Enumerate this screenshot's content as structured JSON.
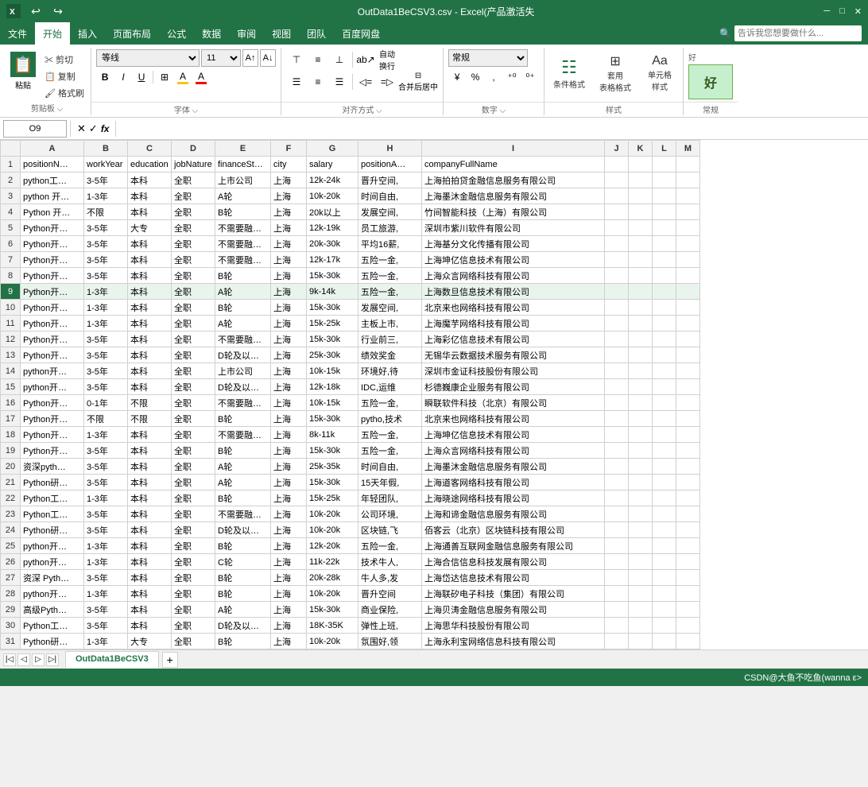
{
  "titleBar": {
    "filename": "OutData1BeCSV3.csv - Excel(产品激活失",
    "iconLabel": "Excel"
  },
  "menuBar": {
    "items": [
      "文件",
      "开始",
      "插入",
      "页面布局",
      "公式",
      "数据",
      "审阅",
      "视图",
      "团队",
      "百度网盘"
    ],
    "activeItem": "开始",
    "searchPlaceholder": "告诉我您想要做什么..."
  },
  "ribbon": {
    "clipboard": {
      "paste": "粘贴",
      "cut": "✂ 剪切",
      "copy": "📋 复制",
      "formatPainter": "🖌 格式刷"
    },
    "font": {
      "name": "等线",
      "size": "11",
      "bold": "B",
      "italic": "I",
      "underline": "U",
      "border": "⊞",
      "fillColor": "A",
      "fontColor": "A"
    },
    "alignment": {
      "wrapText": "自动换行",
      "mergeCenterLabel": "合并后居中"
    },
    "number": {
      "format": "常规",
      "percent": "%",
      "comma": ","
    },
    "styles": {
      "conditionalFormat": "条件格式",
      "tableFormat": "套用\n表格格式",
      "cellStyles": "单元格\n样式"
    },
    "goodStyle": {
      "preview": "好",
      "label": "好"
    }
  },
  "formulaBar": {
    "cellRef": "O9",
    "formula": ""
  },
  "columns": {
    "headers": [
      "",
      "A",
      "B",
      "C",
      "D",
      "E",
      "F",
      "G",
      "H",
      "I",
      "J",
      "K",
      "L",
      "M"
    ],
    "widths": [
      25,
      80,
      55,
      55,
      55,
      70,
      45,
      65,
      80,
      230,
      30,
      30,
      30,
      30
    ]
  },
  "rows": [
    {
      "num": 1,
      "cells": [
        "positionN…",
        "workYear",
        "education",
        "jobNature",
        "financeSt…",
        "city",
        "salary",
        "positionA…",
        "companyFullName",
        "",
        "",
        "",
        ""
      ]
    },
    {
      "num": 2,
      "cells": [
        "python工…",
        "3-5年",
        "本科",
        "全职",
        "上市公司",
        "上海",
        "12k-24k",
        "晋升空间,",
        "上海拍拍贷金融信息服务有限公司",
        "",
        "",
        "",
        ""
      ]
    },
    {
      "num": 3,
      "cells": [
        "python 开…",
        "1-3年",
        "本科",
        "全职",
        "A轮",
        "上海",
        "10k-20k",
        "时间自由,",
        "上海墨沐金融信息服务有限公司",
        "",
        "",
        "",
        ""
      ]
    },
    {
      "num": 4,
      "cells": [
        "Python 开…",
        "不限",
        "本科",
        "全职",
        "B轮",
        "上海",
        "20k以上",
        "发展空间,",
        "竹间智能科技（上海）有限公司",
        "",
        "",
        "",
        ""
      ]
    },
    {
      "num": 5,
      "cells": [
        "Python开…",
        "3-5年",
        "大专",
        "全职",
        "不需要融…",
        "上海",
        "12k-19k",
        "员工旅游,",
        "深圳市紫川软件有限公司",
        "",
        "",
        "",
        ""
      ]
    },
    {
      "num": 6,
      "cells": [
        "Python开…",
        "3-5年",
        "本科",
        "全职",
        "不需要融…",
        "上海",
        "20k-30k",
        "平均16薪,",
        "上海基分文化传播有限公司",
        "",
        "",
        "",
        ""
      ]
    },
    {
      "num": 7,
      "cells": [
        "Python开…",
        "3-5年",
        "本科",
        "全职",
        "不需要融…",
        "上海",
        "12k-17k",
        "五险一金,",
        "上海坤亿信息技术有限公司",
        "",
        "",
        "",
        ""
      ]
    },
    {
      "num": 8,
      "cells": [
        "Python开…",
        "3-5年",
        "本科",
        "全职",
        "B轮",
        "上海",
        "15k-30k",
        "五险一金,",
        "上海众言网络科技有限公司",
        "",
        "",
        "",
        ""
      ]
    },
    {
      "num": 9,
      "cells": [
        "Python开…",
        "1-3年",
        "本科",
        "全职",
        "A轮",
        "上海",
        "9k-14k",
        "五险一金,",
        "上海数旦信息技术有限公司",
        "",
        "",
        "",
        ""
      ],
      "selected": true
    },
    {
      "num": 10,
      "cells": [
        "Python开…",
        "1-3年",
        "本科",
        "全职",
        "B轮",
        "上海",
        "15k-30k",
        "发展空间,",
        "北京来也网络科技有限公司",
        "",
        "",
        "",
        ""
      ]
    },
    {
      "num": 11,
      "cells": [
        "Python开…",
        "1-3年",
        "本科",
        "全职",
        "A轮",
        "上海",
        "15k-25k",
        "主板上市,",
        "上海魔芋网络科技有限公司",
        "",
        "",
        "",
        ""
      ]
    },
    {
      "num": 12,
      "cells": [
        "Python开…",
        "3-5年",
        "本科",
        "全职",
        "不需要融…",
        "上海",
        "15k-30k",
        "行业前三,",
        "上海彩亿信息技术有限公司",
        "",
        "",
        "",
        ""
      ]
    },
    {
      "num": 13,
      "cells": [
        "Python开…",
        "3-5年",
        "本科",
        "全职",
        "D轮及以…",
        "上海",
        "25k-30k",
        "绩效奖金",
        "无锡华云数据技术服务有限公司",
        "",
        "",
        "",
        ""
      ]
    },
    {
      "num": 14,
      "cells": [
        "python开…",
        "3-5年",
        "本科",
        "全职",
        "上市公司",
        "上海",
        "10k-15k",
        "环境好,待",
        "深圳市金证科技股份有限公司",
        "",
        "",
        "",
        ""
      ]
    },
    {
      "num": 15,
      "cells": [
        "python开…",
        "3-5年",
        "本科",
        "全职",
        "D轮及以…",
        "上海",
        "12k-18k",
        "IDC,运维",
        "杉德巍康企业服务有限公司",
        "",
        "",
        "",
        ""
      ]
    },
    {
      "num": 16,
      "cells": [
        "Python开…",
        "0-1年",
        "不限",
        "全职",
        "不需要融…",
        "上海",
        "10k-15k",
        "五险一金,",
        "瞬联软件科技（北京）有限公司",
        "",
        "",
        "",
        ""
      ]
    },
    {
      "num": 17,
      "cells": [
        "Python开…",
        "不限",
        "不限",
        "全职",
        "B轮",
        "上海",
        "15k-30k",
        "pytho,技术",
        "北京来也网络科技有限公司",
        "",
        "",
        "",
        ""
      ]
    },
    {
      "num": 18,
      "cells": [
        "Python开…",
        "1-3年",
        "本科",
        "全职",
        "不需要融…",
        "上海",
        "8k-11k",
        "五险一金,",
        "上海坤亿信息技术有限公司",
        "",
        "",
        "",
        ""
      ]
    },
    {
      "num": 19,
      "cells": [
        "Python开…",
        "3-5年",
        "本科",
        "全职",
        "B轮",
        "上海",
        "15k-30k",
        "五险一金,",
        "上海众言网络科技有限公司",
        "",
        "",
        "",
        ""
      ]
    },
    {
      "num": 20,
      "cells": [
        "资深pyth…",
        "3-5年",
        "本科",
        "全职",
        "A轮",
        "上海",
        "25k-35k",
        "时间自由,",
        "上海墨沐金融信息服务有限公司",
        "",
        "",
        "",
        ""
      ]
    },
    {
      "num": 21,
      "cells": [
        "Python研…",
        "3-5年",
        "本科",
        "全职",
        "A轮",
        "上海",
        "15k-30k",
        "15天年假,",
        "上海道客网络科技有限公司",
        "",
        "",
        "",
        ""
      ]
    },
    {
      "num": 22,
      "cells": [
        "Python工…",
        "1-3年",
        "本科",
        "全职",
        "B轮",
        "上海",
        "15k-25k",
        "年轻团队,",
        "上海晓途网络科技有限公司",
        "",
        "",
        "",
        ""
      ]
    },
    {
      "num": 23,
      "cells": [
        "Python工…",
        "3-5年",
        "本科",
        "全职",
        "不需要融…",
        "上海",
        "10k-20k",
        "公司环境,",
        "上海和谛金融信息服务有限公司",
        "",
        "",
        "",
        ""
      ]
    },
    {
      "num": 24,
      "cells": [
        "Python研…",
        "3-5年",
        "本科",
        "全职",
        "D轮及以…",
        "上海",
        "10k-20k",
        "区块链,飞",
        "佰客云（北京）区块链科技有限公司",
        "",
        "",
        "",
        ""
      ]
    },
    {
      "num": 25,
      "cells": [
        "python开…",
        "1-3年",
        "本科",
        "全职",
        "B轮",
        "上海",
        "12k-20k",
        "五险一金,",
        "上海通善互联网金融信息服务有限公司",
        "",
        "",
        "",
        ""
      ]
    },
    {
      "num": 26,
      "cells": [
        "python开…",
        "1-3年",
        "本科",
        "全职",
        "C轮",
        "上海",
        "11k-22k",
        "技术牛人,",
        "上海合信信息科技发展有限公司",
        "",
        "",
        "",
        ""
      ]
    },
    {
      "num": 27,
      "cells": [
        "资深 Pyth…",
        "3-5年",
        "本科",
        "全职",
        "B轮",
        "上海",
        "20k-28k",
        "牛人多,发",
        "上海岱达信息技术有限公司",
        "",
        "",
        "",
        ""
      ]
    },
    {
      "num": 28,
      "cells": [
        "python开…",
        "1-3年",
        "本科",
        "全职",
        "B轮",
        "上海",
        "10k-20k",
        "晋升空间",
        "上海联矽电子科技（集团）有限公司",
        "",
        "",
        "",
        ""
      ]
    },
    {
      "num": 29,
      "cells": [
        "高级Pyth…",
        "3-5年",
        "本科",
        "全职",
        "A轮",
        "上海",
        "15k-30k",
        "商业保险,",
        "上海贝涛金融信息服务有限公司",
        "",
        "",
        "",
        ""
      ]
    },
    {
      "num": 30,
      "cells": [
        "Python工…",
        "3-5年",
        "本科",
        "全职",
        "D轮及以…",
        "上海",
        "18K-35K",
        "弹性上班,",
        "上海思华科技股份有限公司",
        "",
        "",
        "",
        ""
      ]
    },
    {
      "num": 31,
      "cells": [
        "Python研…",
        "1-3年",
        "大专",
        "全职",
        "B轮",
        "上海",
        "10k-20k",
        "氛围好,领",
        "上海永利宝网络信息科技有限公司",
        "",
        "",
        "",
        ""
      ]
    }
  ],
  "sheetTabs": {
    "tabs": [
      "OutData1BeCSV3"
    ],
    "activeTab": "OutData1BeCSV3",
    "addButton": "+"
  },
  "statusBar": {
    "left": "",
    "right": "CSDN@大鱼不吃鱼(wanna ε>"
  }
}
